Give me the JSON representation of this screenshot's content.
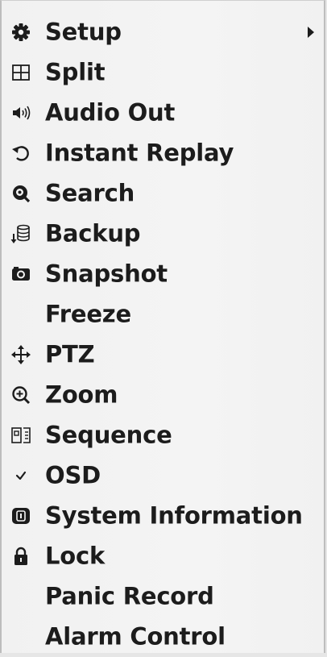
{
  "menu": {
    "items": [
      {
        "label": "Setup",
        "icon": "gear-icon"
      },
      {
        "label": "Split",
        "icon": "grid-icon"
      },
      {
        "label": "Audio Out",
        "icon": "speaker-icon"
      },
      {
        "label": "Instant Replay",
        "icon": "replay-icon"
      },
      {
        "label": "Search",
        "icon": "search-icon"
      },
      {
        "label": "Backup",
        "icon": "backup-icon"
      },
      {
        "label": "Snapshot",
        "icon": "camera-icon"
      },
      {
        "label": "Freeze",
        "icon": ""
      },
      {
        "label": "PTZ",
        "icon": "move-icon"
      },
      {
        "label": "Zoom",
        "icon": "zoom-icon"
      },
      {
        "label": "Sequence",
        "icon": "sequence-icon"
      },
      {
        "label": "OSD",
        "icon": "checkmark-icon"
      },
      {
        "label": "System Information",
        "icon": "info-icon"
      },
      {
        "label": "Lock",
        "icon": "lock-icon"
      },
      {
        "label": "Panic Record",
        "icon": ""
      },
      {
        "label": "Alarm Control",
        "icon": ""
      }
    ]
  }
}
